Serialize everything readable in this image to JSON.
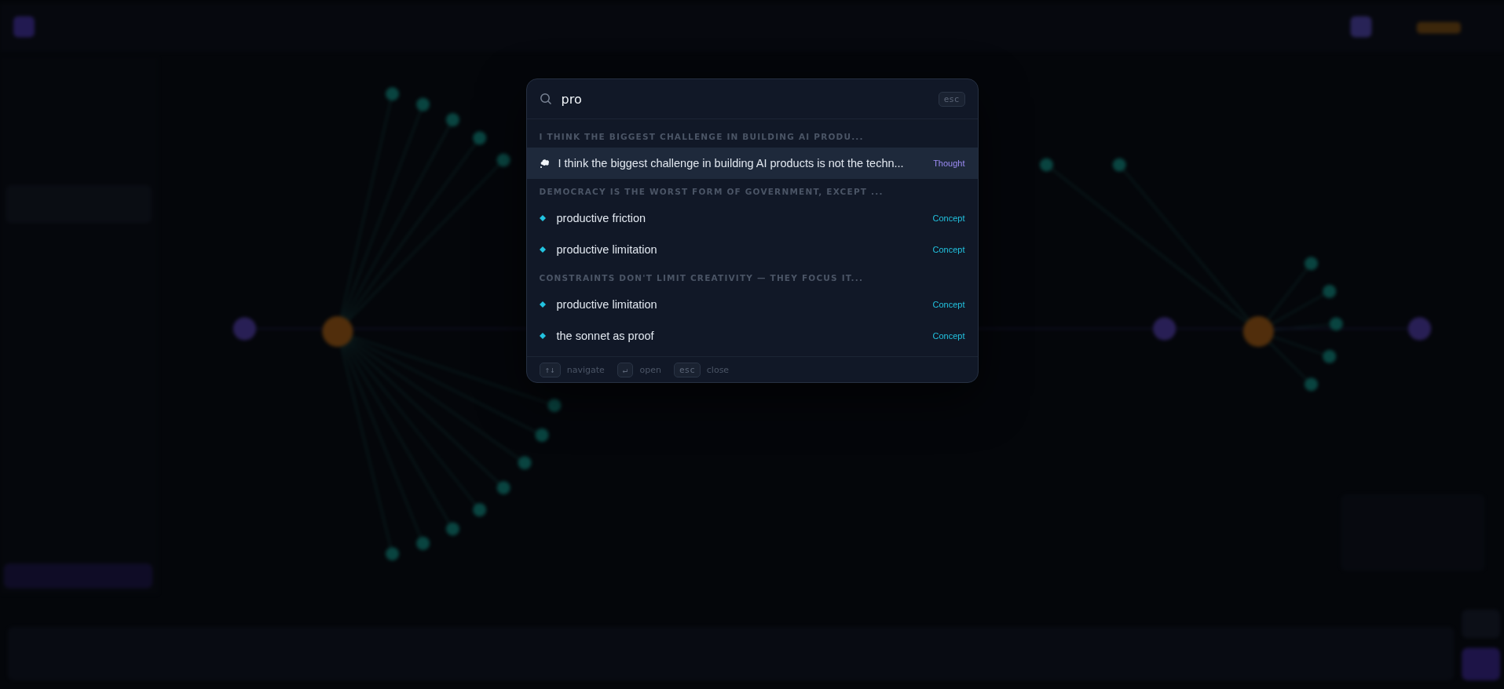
{
  "search": {
    "value": "pro",
    "esc_key": "esc"
  },
  "groups": [
    {
      "heading": "I THINK THE BIGGEST CHALLENGE IN BUILDING AI PRODU...",
      "results": [
        {
          "kind": "thought",
          "title": "I think the biggest challenge in building AI products is not the techn...",
          "type": "Thought",
          "selected": true
        }
      ]
    },
    {
      "heading": "DEMOCRACY IS THE WORST FORM OF GOVERNMENT, EXCEPT ...",
      "results": [
        {
          "kind": "concept",
          "title": "productive friction",
          "type": "Concept",
          "selected": false
        },
        {
          "kind": "concept",
          "title": "productive limitation",
          "type": "Concept",
          "selected": false
        }
      ]
    },
    {
      "heading": "CONSTRAINTS DON'T LIMIT CREATIVITY — THEY FOCUS IT...",
      "results": [
        {
          "kind": "concept",
          "title": "productive limitation",
          "type": "Concept",
          "selected": false
        },
        {
          "kind": "concept",
          "title": "the sonnet as proof",
          "type": "Concept",
          "selected": false
        }
      ]
    }
  ],
  "footer_hints": [
    {
      "key": "↑↓",
      "label": "navigate"
    },
    {
      "key": "↵",
      "label": "open"
    },
    {
      "key": "esc",
      "label": "close"
    }
  ]
}
